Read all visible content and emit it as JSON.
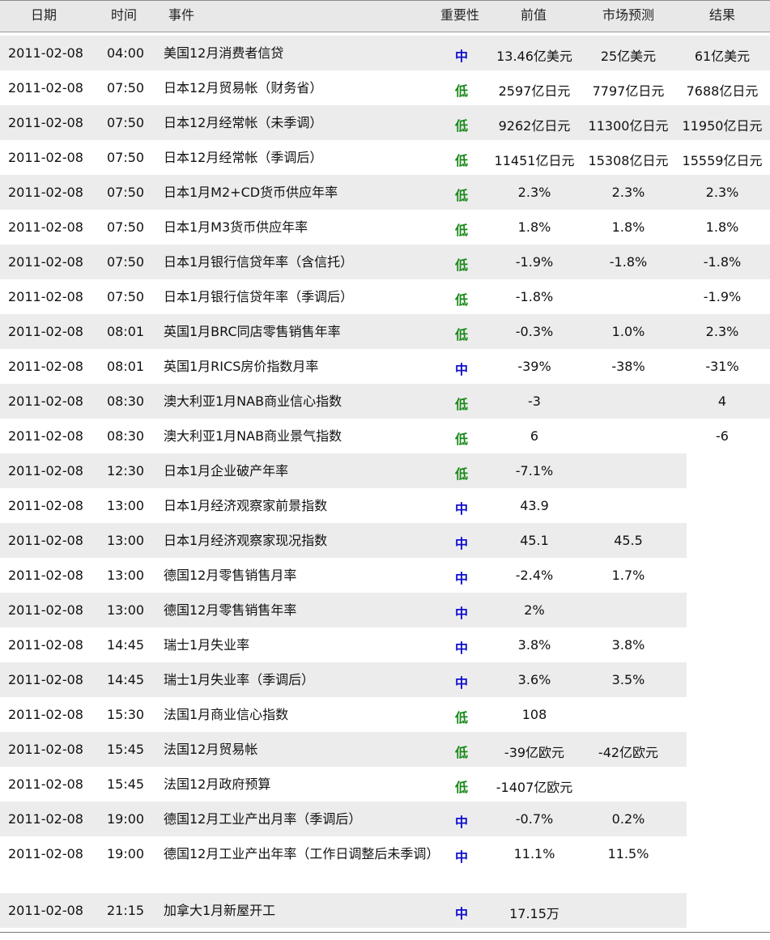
{
  "headers": {
    "date": "日期",
    "time": "时间",
    "event": "事件",
    "importance": "重要性",
    "previous": "前值",
    "forecast": "市场预测",
    "result": "结果"
  },
  "rows": [
    {
      "date": "2011-02-08",
      "time": "04:00",
      "event": "美国12月消费者信贷",
      "importance": "中",
      "previous": "13.46亿美元",
      "forecast": "25亿美元",
      "result": "61亿美元"
    },
    {
      "date": "2011-02-08",
      "time": "07:50",
      "event": "日本12月贸易帐（财务省）",
      "importance": "低",
      "previous": "2597亿日元",
      "forecast": "7797亿日元",
      "result": "7688亿日元"
    },
    {
      "date": "2011-02-08",
      "time": "07:50",
      "event": "日本12月经常帐（未季调）",
      "importance": "低",
      "previous": "9262亿日元",
      "forecast": "11300亿日元",
      "result": "11950亿日元"
    },
    {
      "date": "2011-02-08",
      "time": "07:50",
      "event": "日本12月经常帐（季调后）",
      "importance": "低",
      "previous": "11451亿日元",
      "forecast": "15308亿日元",
      "result": "15559亿日元"
    },
    {
      "date": "2011-02-08",
      "time": "07:50",
      "event": "日本1月M2+CD货币供应年率",
      "importance": "低",
      "previous": "2.3%",
      "forecast": "2.3%",
      "result": "2.3%"
    },
    {
      "date": "2011-02-08",
      "time": "07:50",
      "event": "日本1月M3货币供应年率",
      "importance": "低",
      "previous": "1.8%",
      "forecast": "1.8%",
      "result": "1.8%"
    },
    {
      "date": "2011-02-08",
      "time": "07:50",
      "event": "日本1月银行信贷年率（含信托）",
      "importance": "低",
      "previous": "-1.9%",
      "forecast": "-1.8%",
      "result": "-1.8%"
    },
    {
      "date": "2011-02-08",
      "time": "07:50",
      "event": "日本1月银行信贷年率（季调后）",
      "importance": "低",
      "previous": "-1.8%",
      "forecast": "",
      "result": "-1.9%"
    },
    {
      "date": "2011-02-08",
      "time": "08:01",
      "event": "英国1月BRC同店零售销售年率",
      "importance": "低",
      "previous": "-0.3%",
      "forecast": "1.0%",
      "result": "2.3%"
    },
    {
      "date": "2011-02-08",
      "time": "08:01",
      "event": "英国1月RICS房价指数月率",
      "importance": "中",
      "previous": "-39%",
      "forecast": "-38%",
      "result": "-31%"
    },
    {
      "date": "2011-02-08",
      "time": "08:30",
      "event": "澳大利亚1月NAB商业信心指数",
      "importance": "低",
      "previous": "-3",
      "forecast": "",
      "result": "4"
    },
    {
      "date": "2011-02-08",
      "time": "08:30",
      "event": "澳大利亚1月NAB商业景气指数",
      "importance": "低",
      "previous": "6",
      "forecast": "",
      "result": "-6"
    },
    {
      "date": "2011-02-08",
      "time": "12:30",
      "event": "日本1月企业破产年率",
      "importance": "低",
      "previous": "-7.1%",
      "forecast": "",
      "result": ""
    },
    {
      "date": "2011-02-08",
      "time": "13:00",
      "event": "日本1月经济观察家前景指数",
      "importance": "中",
      "previous": "43.9",
      "forecast": "",
      "result": ""
    },
    {
      "date": "2011-02-08",
      "time": "13:00",
      "event": "日本1月经济观察家现况指数",
      "importance": "中",
      "previous": "45.1",
      "forecast": "45.5",
      "result": ""
    },
    {
      "date": "2011-02-08",
      "time": "13:00",
      "event": "德国12月零售销售月率",
      "importance": "中",
      "previous": "-2.4%",
      "forecast": "1.7%",
      "result": ""
    },
    {
      "date": "2011-02-08",
      "time": "13:00",
      "event": "德国12月零售销售年率",
      "importance": "中",
      "previous": "2%",
      "forecast": "",
      "result": ""
    },
    {
      "date": "2011-02-08",
      "time": "14:45",
      "event": "瑞士1月失业率",
      "importance": "中",
      "previous": "3.8%",
      "forecast": "3.8%",
      "result": ""
    },
    {
      "date": "2011-02-08",
      "time": "14:45",
      "event": "瑞士1月失业率（季调后）",
      "importance": "中",
      "previous": "3.6%",
      "forecast": "3.5%",
      "result": ""
    },
    {
      "date": "2011-02-08",
      "time": "15:30",
      "event": "法国1月商业信心指数",
      "importance": "低",
      "previous": "108",
      "forecast": "",
      "result": ""
    },
    {
      "date": "2011-02-08",
      "time": "15:45",
      "event": "法国12月贸易帐",
      "importance": "低",
      "previous": "-39亿欧元",
      "forecast": "-42亿欧元",
      "result": ""
    },
    {
      "date": "2011-02-08",
      "time": "15:45",
      "event": "法国12月政府预算",
      "importance": "低",
      "previous": "-1407亿欧元",
      "forecast": "",
      "result": ""
    },
    {
      "date": "2011-02-08",
      "time": "19:00",
      "event": "德国12月工业产出月率（季调后）",
      "importance": "中",
      "previous": "-0.7%",
      "forecast": "0.2%",
      "result": ""
    },
    {
      "date": "2011-02-08",
      "time": "19:00",
      "event": "德国12月工业产出年率（工作日调整后未季调）",
      "importance": "中",
      "previous": "11.1%",
      "forecast": "11.5%",
      "result": ""
    },
    {
      "date": "2011-02-08",
      "time": "21:15",
      "event": "加拿大1月新屋开工",
      "importance": "中",
      "previous": "17.15万",
      "forecast": "",
      "result": ""
    }
  ],
  "colors": {
    "importance_mid": "#1010cc",
    "importance_low": "#1a8a1a",
    "stripe": "#ececec",
    "header_bg": "#e8e8e8"
  }
}
